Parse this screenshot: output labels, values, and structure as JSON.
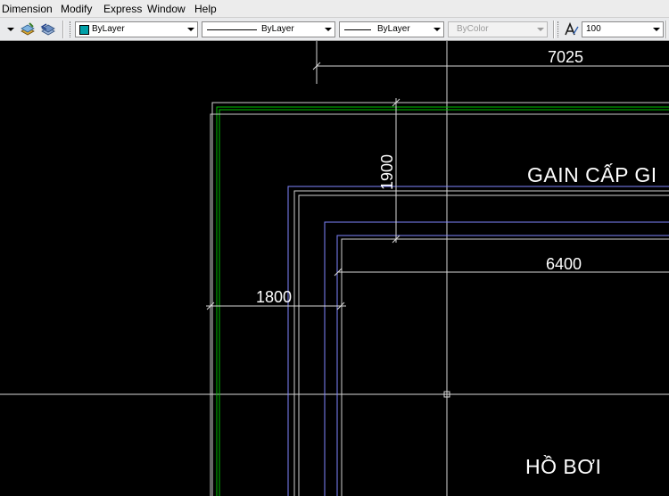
{
  "menu": [
    "Dimension",
    "Modify",
    "Express",
    "Window",
    "Help"
  ],
  "toolbar": {
    "color_value": "ByLayer",
    "linetype_value": "ByLayer",
    "lineweight_value": "ByLayer",
    "plotstyle_value": "ByColor",
    "annotation_scale_value": "100",
    "color_swatch": "#00a0a8"
  },
  "drawing": {
    "dimensions": [
      "7025",
      "1900",
      "6400",
      "1800"
    ],
    "labels": [
      "GAIN CẤP GI",
      "HỒ BƠI"
    ]
  }
}
